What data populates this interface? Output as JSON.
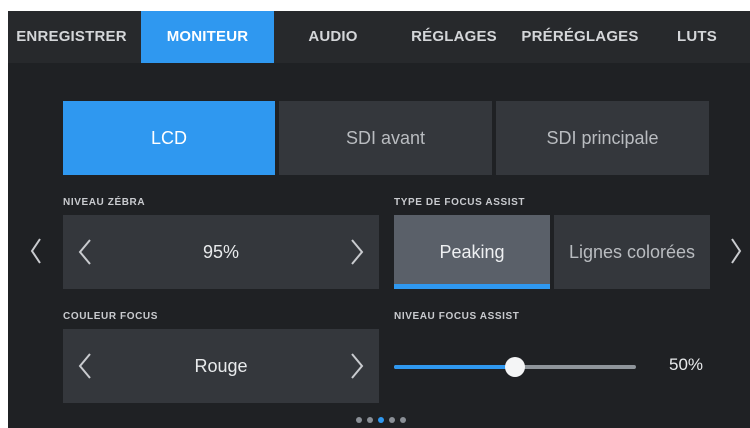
{
  "tabs": [
    {
      "label": "ENREGISTRER",
      "active": false
    },
    {
      "label": "MONITEUR",
      "active": true
    },
    {
      "label": "AUDIO",
      "active": false
    },
    {
      "label": "RÉGLAGES",
      "active": false
    },
    {
      "label": "PRÉRÉGLAGES",
      "active": false
    },
    {
      "label": "LUTS",
      "active": false
    }
  ],
  "outputs": [
    {
      "label": "LCD",
      "active": true
    },
    {
      "label": "SDI avant",
      "active": false
    },
    {
      "label": "SDI principale",
      "active": false
    }
  ],
  "zebra": {
    "label": "NIVEAU ZÉBRA",
    "value": "95%"
  },
  "focus_type": {
    "label": "TYPE DE FOCUS ASSIST",
    "options": [
      {
        "label": "Peaking",
        "active": true
      },
      {
        "label": "Lignes colorées",
        "active": false
      }
    ]
  },
  "focus_color": {
    "label": "COULEUR FOCUS",
    "value": "Rouge"
  },
  "focus_level": {
    "label": "NIVEAU FOCUS ASSIST",
    "value_text": "50%",
    "fraction": 0.5
  },
  "pagination": {
    "count": 5,
    "active_index": 2
  },
  "colors": {
    "accent": "#2f98f0",
    "background": "#1f2124",
    "panel": "#34373c"
  },
  "icons": {
    "prev": "chevron-left-icon",
    "next": "chevron-right-icon"
  }
}
